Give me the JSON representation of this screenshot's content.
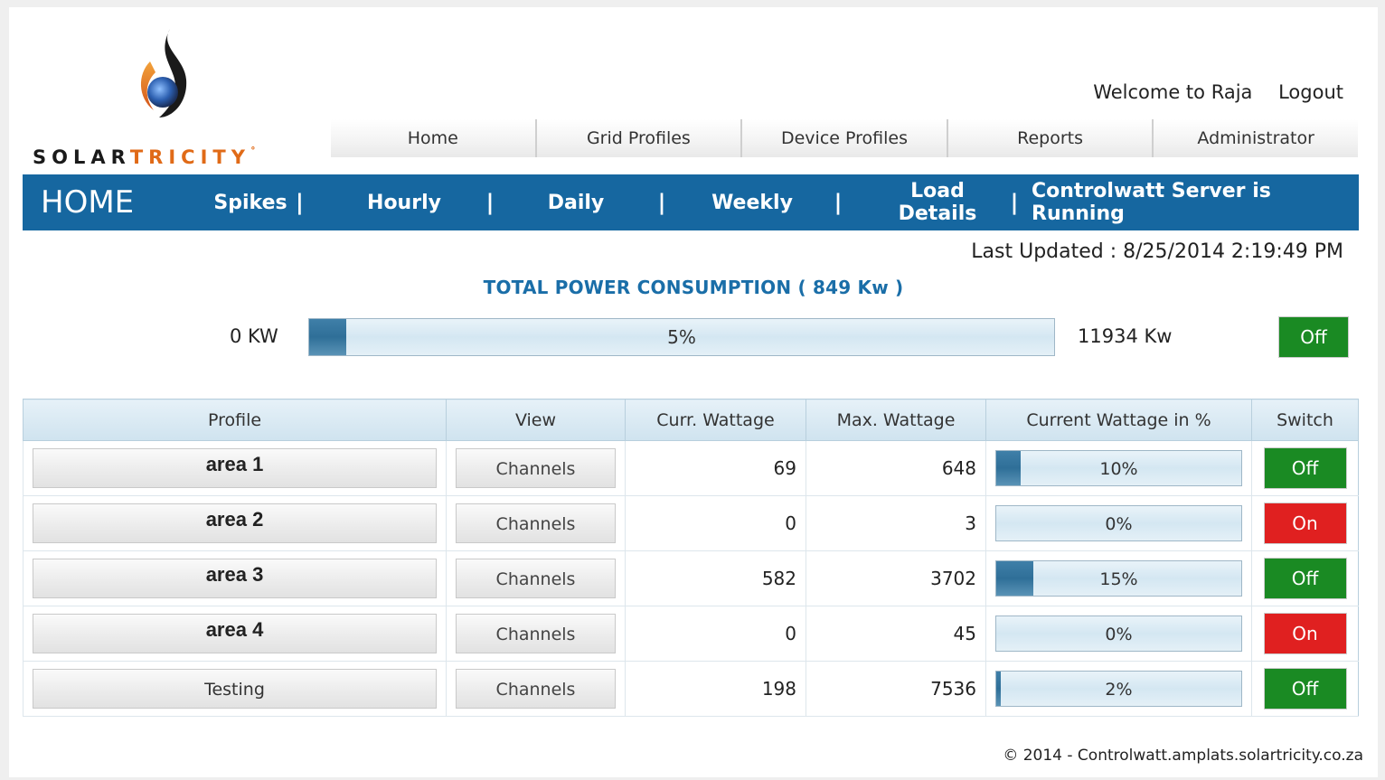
{
  "brand": {
    "part1": "SOLAR",
    "part2": "TRICITY",
    "tm": "˚"
  },
  "welcome": {
    "text": "Welcome to Raja",
    "logout": "Logout"
  },
  "topnav": [
    "Home",
    "Grid Profiles",
    "Device Profiles",
    "Reports",
    "Administrator"
  ],
  "subnav": {
    "title": "HOME",
    "links": [
      "Spikes",
      "Hourly",
      "Daily",
      "Weekly",
      "Load Details"
    ],
    "status": "Controlwatt Server is Running",
    "separator": "|"
  },
  "last_updated": "Last Updated : 8/25/2014 2:19:49 PM",
  "total": {
    "title": "TOTAL POWER CONSUMPTION ( 849 Kw )",
    "min_label": "0 KW",
    "max_label": "11934 Kw",
    "percent": 5,
    "percent_label": "5%",
    "switch_label": "Off",
    "switch_state": "off"
  },
  "table": {
    "headers": [
      "Profile",
      "View",
      "Curr. Wattage",
      "Max. Wattage",
      "Current Wattage in %",
      "Switch"
    ],
    "rows": [
      {
        "profile": "area 1",
        "view": "Channels",
        "curr": "69",
        "max": "648",
        "percent": 10,
        "percent_label": "10%",
        "switch": "Off",
        "state": "off"
      },
      {
        "profile": "area 2",
        "view": "Channels",
        "curr": "0",
        "max": "3",
        "percent": 0,
        "percent_label": "0%",
        "switch": "On",
        "state": "on"
      },
      {
        "profile": "area 3",
        "view": "Channels",
        "curr": "582",
        "max": "3702",
        "percent": 15,
        "percent_label": "15%",
        "switch": "Off",
        "state": "off"
      },
      {
        "profile": "area 4",
        "view": "Channels",
        "curr": "0",
        "max": "45",
        "percent": 0,
        "percent_label": "0%",
        "switch": "On",
        "state": "on"
      },
      {
        "profile": "Testing",
        "view": "Channels",
        "curr": "198",
        "max": "7536",
        "percent": 2,
        "percent_label": "2%",
        "switch": "Off",
        "state": "off"
      }
    ]
  },
  "footer": "© 2014 - Controlwatt.amplats.solartricity.co.za",
  "colors": {
    "header_blue": "#1667a0",
    "title_blue": "#1a6ea8",
    "switch_off": "#1a8a23",
    "switch_on": "#e02020",
    "brand_orange": "#e06a17"
  }
}
